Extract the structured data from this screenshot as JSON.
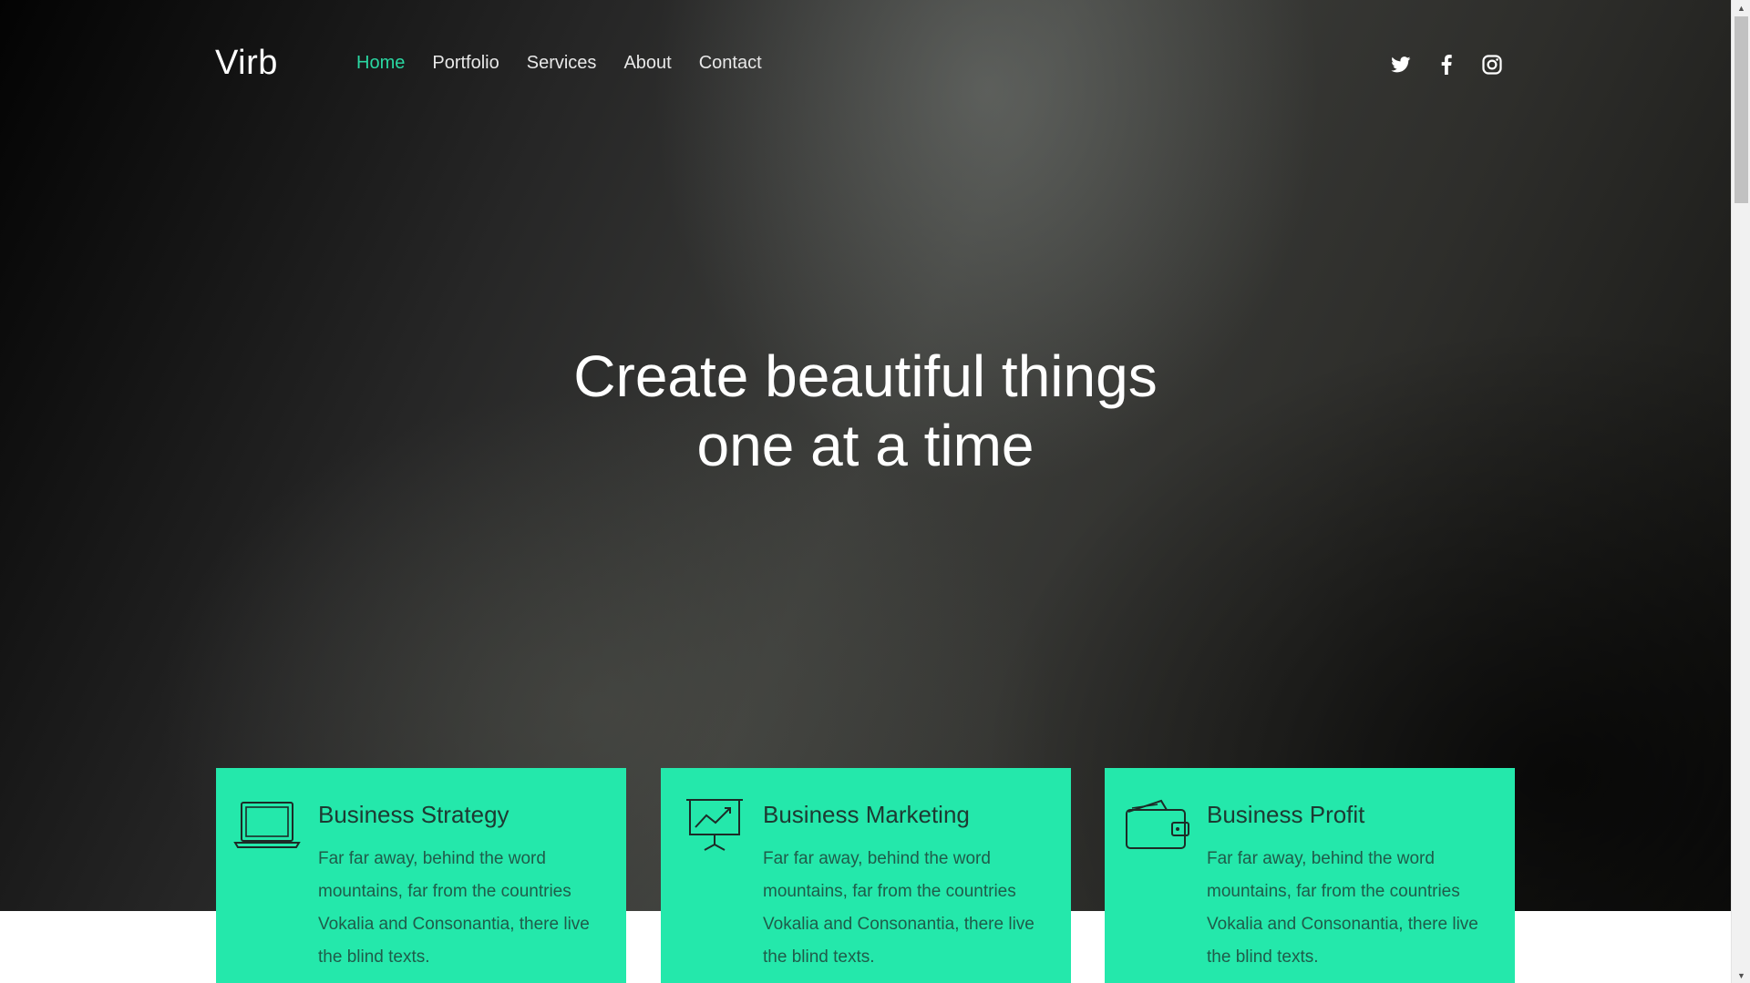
{
  "brand": "Virb",
  "nav": {
    "items": [
      {
        "label": "Home",
        "active": true
      },
      {
        "label": "Portfolio",
        "active": false
      },
      {
        "label": "Services",
        "active": false
      },
      {
        "label": "About",
        "active": false
      },
      {
        "label": "Contact",
        "active": false
      }
    ]
  },
  "social": {
    "icons": [
      "twitter-icon",
      "facebook-icon",
      "instagram-icon"
    ]
  },
  "hero": {
    "line1": "Create beautiful things",
    "line2": "one at a time"
  },
  "cards": [
    {
      "icon": "laptop-icon",
      "title": "Business Strategy",
      "text": "Far far away, behind the word mountains, far from the countries Vokalia and Consonantia, there live the blind texts."
    },
    {
      "icon": "presentation-chart-icon",
      "title": "Business Marketing",
      "text": "Far far away, behind the word mountains, far from the countries Vokalia and Consonantia, there live the blind texts."
    },
    {
      "icon": "wallet-icon",
      "title": "Business Profit",
      "text": "Far far away, behind the word mountains, far from the countries Vokalia and Consonantia, there live the blind texts."
    }
  ],
  "colors": {
    "accent": "#2ad7a2",
    "card_bg": "#24e8ab",
    "hero_text": "#ffffff"
  }
}
